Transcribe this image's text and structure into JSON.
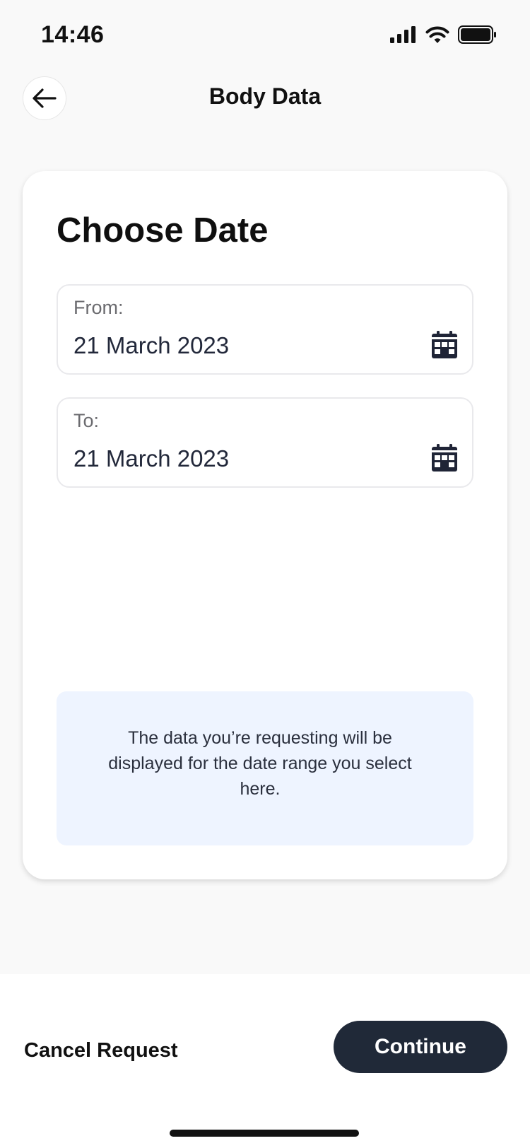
{
  "status_bar": {
    "time": "14:46",
    "icons": [
      "cellular-signal-icon",
      "wifi-icon",
      "battery-icon"
    ]
  },
  "header": {
    "title": "Body Data",
    "back_icon": "arrow-left-icon"
  },
  "card": {
    "title": "Choose Date",
    "from": {
      "label": "From:",
      "value": "21 March 2023",
      "icon": "calendar-icon"
    },
    "to": {
      "label": "To:",
      "value": "21 March 2023",
      "icon": "calendar-icon"
    },
    "info_text": "The data you’re requesting will be displayed for the date range you select here."
  },
  "footer": {
    "cancel_label": "Cancel Request",
    "continue_label": "Continue"
  },
  "colors": {
    "page_background": "#f9f9f9",
    "primary_button": "#202938",
    "info_background": "#eef4ff",
    "field_border": "#e9e9ec"
  }
}
